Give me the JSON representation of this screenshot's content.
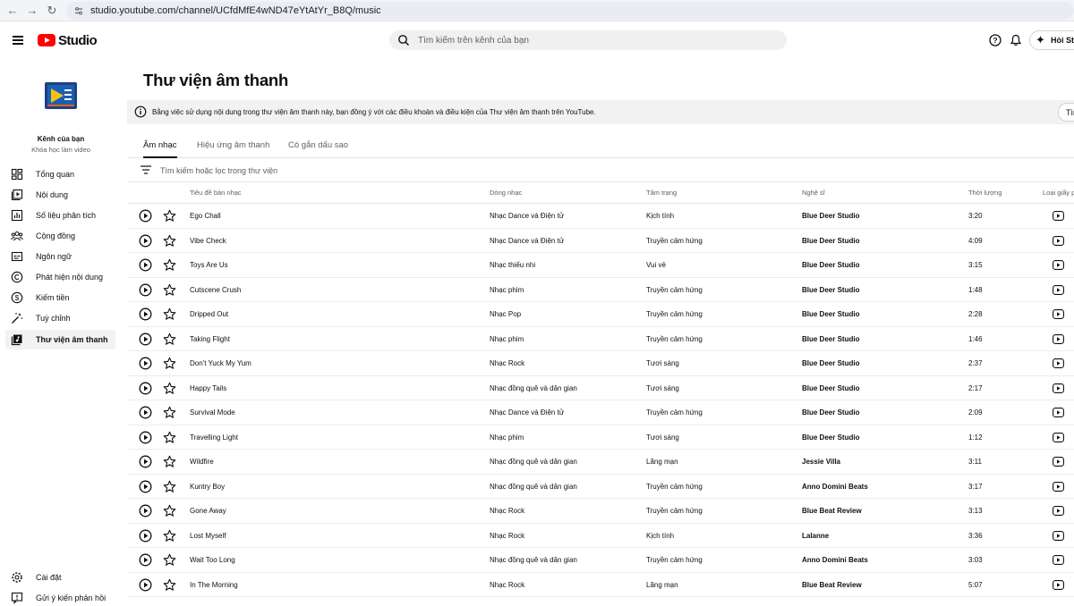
{
  "browser": {
    "url": "studio.youtube.com/channel/UCfdMfE4wND47eYtAtYr_B8Q/music"
  },
  "header": {
    "logo_text": "Studio",
    "search_placeholder": "Tìm kiếm trên kênh của bạn",
    "ask_label": "Hỏi Stu"
  },
  "sidebar": {
    "channel_name": "Kênh của bạn",
    "channel_sub": "Khóa học làm video",
    "items": [
      {
        "label": "Tổng quan",
        "icon": "dashboard-icon"
      },
      {
        "label": "Nội dung",
        "icon": "content-icon"
      },
      {
        "label": "Số liệu phân tích",
        "icon": "analytics-icon"
      },
      {
        "label": "Cộng đồng",
        "icon": "community-icon"
      },
      {
        "label": "Ngôn ngữ",
        "icon": "subtitles-icon"
      },
      {
        "label": "Phát hiện nội dung",
        "icon": "copyright-icon"
      },
      {
        "label": "Kiếm tiền",
        "icon": "earn-icon"
      },
      {
        "label": "Tuỳ chỉnh",
        "icon": "magic-wand-icon"
      },
      {
        "label": "Thư viện âm thanh",
        "icon": "audio-library-icon",
        "active": true
      }
    ],
    "bottom_items": [
      {
        "label": "Cài đặt",
        "icon": "gear-icon"
      },
      {
        "label": "Gửi ý kiến phản hồi",
        "icon": "feedback-icon"
      }
    ]
  },
  "main": {
    "title": "Thư viện âm thanh",
    "notice": "Bằng việc sử dụng nội dung trong thư viện âm thanh này, bạn đồng ý với các điều khoản và điều kiện của Thư viện âm thanh trên YouTube.",
    "notice_button": "Tìm",
    "tabs": [
      {
        "label": "Âm nhạc",
        "active": true
      },
      {
        "label": "Hiệu ứng âm thanh"
      },
      {
        "label": "Có gắn dấu sao"
      }
    ],
    "filter_placeholder": "Tìm kiếm hoặc lọc trong thư viện",
    "columns": {
      "title": "Tiêu đề bản nhạc",
      "genre": "Dòng nhạc",
      "mood": "Tâm trạng",
      "artist": "Nghệ sĩ",
      "duration": "Thời lượng",
      "license": "Loại giấy p"
    },
    "tracks": [
      {
        "title": "Ego Chall",
        "genre": "Nhạc Dance và Điện tử",
        "mood": "Kịch tính",
        "artist": "Blue Deer Studio",
        "duration": "3:20"
      },
      {
        "title": "Vibe Check",
        "genre": "Nhạc Dance và Điện tử",
        "mood": "Truyền cảm hứng",
        "artist": "Blue Deer Studio",
        "duration": "4:09"
      },
      {
        "title": "Toys Are Us",
        "genre": "Nhạc thiếu nhi",
        "mood": "Vui vẻ",
        "artist": "Blue Deer Studio",
        "duration": "3:15"
      },
      {
        "title": "Cutscene Crush",
        "genre": "Nhạc phim",
        "mood": "Truyền cảm hứng",
        "artist": "Blue Deer Studio",
        "duration": "1:48"
      },
      {
        "title": "Dripped Out",
        "genre": "Nhạc Pop",
        "mood": "Truyền cảm hứng",
        "artist": "Blue Deer Studio",
        "duration": "2:28"
      },
      {
        "title": "Taking Flight",
        "genre": "Nhạc phim",
        "mood": "Truyền cảm hứng",
        "artist": "Blue Deer Studio",
        "duration": "1:46"
      },
      {
        "title": "Don't Yuck My Yum",
        "genre": "Nhạc Rock",
        "mood": "Tươi sáng",
        "artist": "Blue Deer Studio",
        "duration": "2:37"
      },
      {
        "title": "Happy Tails",
        "genre": "Nhạc đồng quê và dân gian",
        "mood": "Tươi sáng",
        "artist": "Blue Deer Studio",
        "duration": "2:17"
      },
      {
        "title": "Survival Mode",
        "genre": "Nhạc Dance và Điện tử",
        "mood": "Truyền cảm hứng",
        "artist": "Blue Deer Studio",
        "duration": "2:09"
      },
      {
        "title": "Travelling Light",
        "genre": "Nhạc phim",
        "mood": "Tươi sáng",
        "artist": "Blue Deer Studio",
        "duration": "1:12"
      },
      {
        "title": "Wildfire",
        "genre": "Nhạc đồng quê và dân gian",
        "mood": "Lãng mạn",
        "artist": "Jessie Villa",
        "duration": "3:11"
      },
      {
        "title": "Kuntry Boy",
        "genre": "Nhạc đồng quê và dân gian",
        "mood": "Truyền cảm hứng",
        "artist": "Anno Domini Beats",
        "duration": "3:17"
      },
      {
        "title": "Gone Away",
        "genre": "Nhạc Rock",
        "mood": "Truyền cảm hứng",
        "artist": "Blue Beat Review",
        "duration": "3:13"
      },
      {
        "title": "Lost Myself",
        "genre": "Nhạc Rock",
        "mood": "Kịch tính",
        "artist": "Lalanne",
        "duration": "3:36"
      },
      {
        "title": "Wait Too Long",
        "genre": "Nhạc đồng quê và dân gian",
        "mood": "Truyền cảm hứng",
        "artist": "Anno Domini Beats",
        "duration": "3:03"
      },
      {
        "title": "In The Morning",
        "genre": "Nhạc Rock",
        "mood": "Lãng mạn",
        "artist": "Blue Beat Review",
        "duration": "5:07"
      }
    ]
  },
  "colors": {
    "brand_red": "#ff0000",
    "text_primary": "#0f0f0f",
    "text_secondary": "#606060",
    "surface": "#f2f2f2"
  }
}
